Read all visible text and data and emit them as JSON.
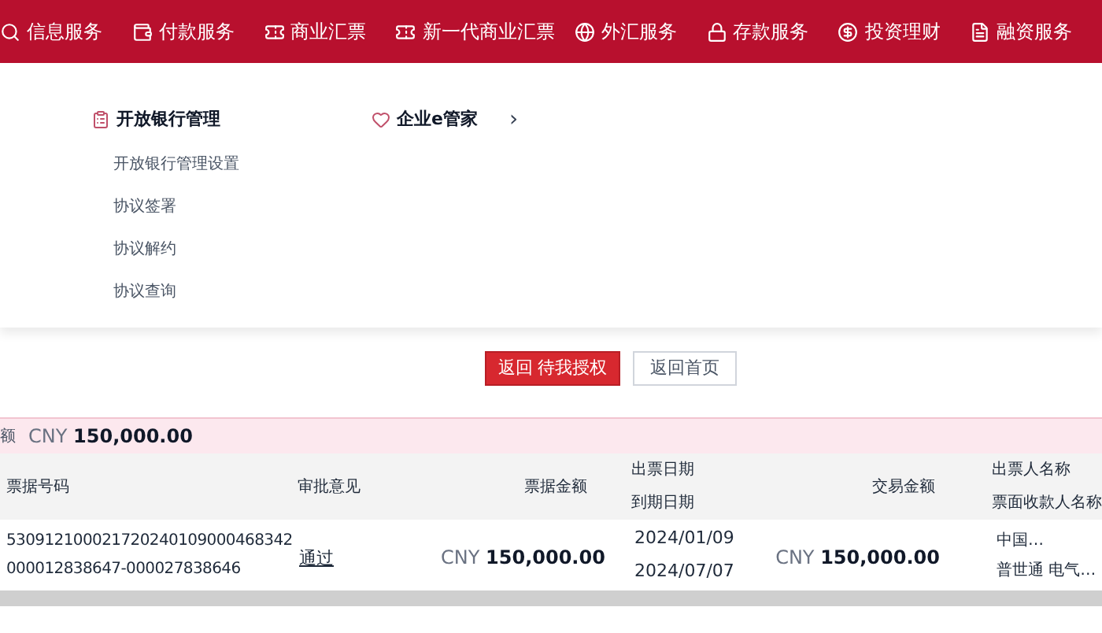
{
  "nav": [
    {
      "label": "信息服务"
    },
    {
      "label": "付款服务"
    },
    {
      "label": "商业汇票"
    },
    {
      "label": "新一代商业汇票"
    },
    {
      "label": "外汇服务"
    },
    {
      "label": "存款服务"
    },
    {
      "label": "投资理财"
    },
    {
      "label": "融资服务"
    }
  ],
  "menu": {
    "groups": [
      {
        "title": "开放银行管理",
        "items": [
          "开放银行管理设置",
          "协议签署",
          "协议解约",
          "协议查询"
        ]
      },
      {
        "title": "企业e管家",
        "arrow": "›"
      }
    ]
  },
  "result": {
    "buttons": [
      {
        "label": "返回 待我授权",
        "primary": true
      },
      {
        "label": "返回首页",
        "primary": false
      }
    ]
  },
  "total": {
    "label": "额",
    "currency": "CNY",
    "amount": "150,000.00"
  },
  "table": {
    "columns": [
      [
        "票据号码"
      ],
      [
        "审批意见"
      ],
      [
        "票据金额"
      ],
      [
        "出票日期",
        "到期日期"
      ],
      [
        "交易金额"
      ],
      [
        "出票人名称",
        "票面收款人名称"
      ]
    ],
    "rows": [
      {
        "bill_no": [
          "530912100021720240109000468342",
          "000012838647-000027838646"
        ],
        "approval": "通过",
        "bill_amount": {
          "currency": "CNY",
          "amount": "150,000.00"
        },
        "dates": [
          "2024/01/09",
          "2024/07/07"
        ],
        "trade_amount": {
          "currency": "CNY",
          "amount": "150,000.00"
        },
        "parties": [
          "中国…",
          "普世通 电气…"
        ]
      }
    ]
  }
}
